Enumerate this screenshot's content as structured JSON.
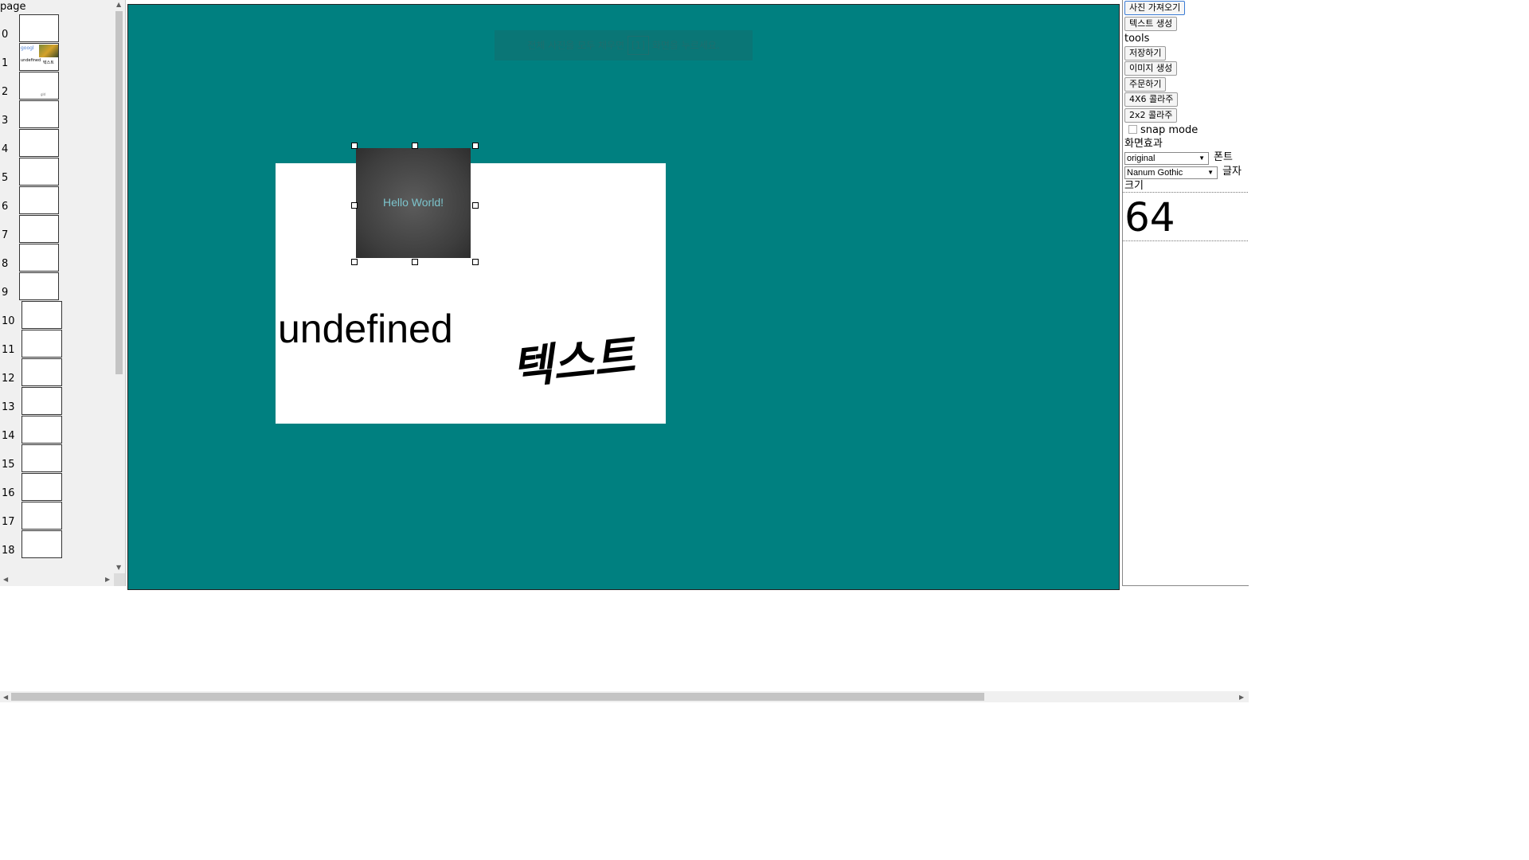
{
  "left_panel": {
    "header": "page",
    "pages": [
      "0",
      "1",
      "2",
      "3",
      "4",
      "5",
      "6",
      "7",
      "8",
      "9",
      "10",
      "11",
      "12",
      "13",
      "14",
      "15",
      "16",
      "17",
      "18"
    ],
    "thumb1": {
      "texts": [
        "googl",
        "undefined",
        "텍스트"
      ]
    },
    "thumb2": {
      "text": "gld"
    }
  },
  "canvas": {
    "background": "#008080",
    "hint": {
      "before": "전체 사진을 모두 채우면",
      "box": "[1]",
      "after": "화면을 누르세요."
    },
    "paper_texts": {
      "english": "undefined",
      "korean": "텍스트"
    },
    "selected_image": {
      "label": "Hello World!"
    }
  },
  "right_panel": {
    "buttons_top": [
      "사진 가져오기",
      "텍스트 생성"
    ],
    "tools_label": "tools",
    "tools": [
      "저장하기",
      "이미지 생성",
      "주문하기",
      "4X6 콜라주",
      "2x2 콜라주"
    ],
    "snap_mode": {
      "label": "snap mode",
      "checked": false
    },
    "effect_label": "화면효과",
    "effect_select": "original",
    "font_label": "폰트",
    "font_select": "Nanum Gothic",
    "size_label_1": "글자",
    "size_label_2": "크기",
    "size_value": "64"
  }
}
